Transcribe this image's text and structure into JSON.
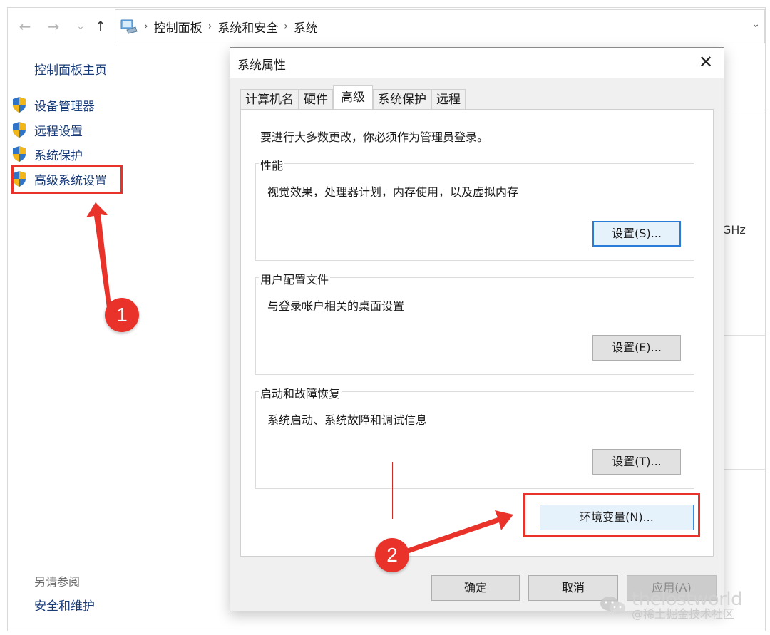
{
  "explorer": {
    "breadcrumbs": [
      "控制面板",
      "系统和安全",
      "系统"
    ],
    "nav": {
      "back_glyph": "←",
      "forward_glyph": "→",
      "recent_glyph": "⌄",
      "up_glyph": "↑",
      "dropdown_glyph": "⌄",
      "sep_glyph": "›"
    },
    "left_nav": {
      "home": "控制面板主页",
      "items": [
        {
          "label": "设备管理器",
          "icon": "shield-icon"
        },
        {
          "label": "远程设置",
          "icon": "shield-icon"
        },
        {
          "label": "系统保护",
          "icon": "shield-icon"
        },
        {
          "label": "高级系统设置",
          "icon": "shield-icon"
        }
      ],
      "see_also_heading": "另请参阅",
      "see_also_link": "安全和维护"
    },
    "right_fragment": "GHz"
  },
  "dialog": {
    "title": "系统属性",
    "close_glyph": "✕",
    "tabs": [
      {
        "label": "计算机名",
        "active": false
      },
      {
        "label": "硬件",
        "active": false
      },
      {
        "label": "高级",
        "active": true
      },
      {
        "label": "系统保护",
        "active": false
      },
      {
        "label": "远程",
        "active": false
      }
    ],
    "notice": "要进行大多数更改，你必须作为管理员登录。",
    "groups": [
      {
        "label": "性能",
        "desc": "视觉效果，处理器计划，内存使用，以及虚拟内存",
        "button": "设置(S)..."
      },
      {
        "label": "用户配置文件",
        "desc": "与登录帐户相关的桌面设置",
        "button": "设置(E)..."
      },
      {
        "label": "启动和故障恢复",
        "desc": "系统启动、系统故障和调试信息",
        "button": "设置(T)..."
      }
    ],
    "env_button": "环境变量(N)...",
    "footer": {
      "ok": "确定",
      "cancel": "取消",
      "apply": "应用(A)"
    }
  },
  "annotations": {
    "marker1": "1",
    "marker2": "2",
    "color": "#e8322a"
  },
  "watermark": {
    "line1": "thelostworld",
    "line2": "@稀土掘金技术社区"
  }
}
